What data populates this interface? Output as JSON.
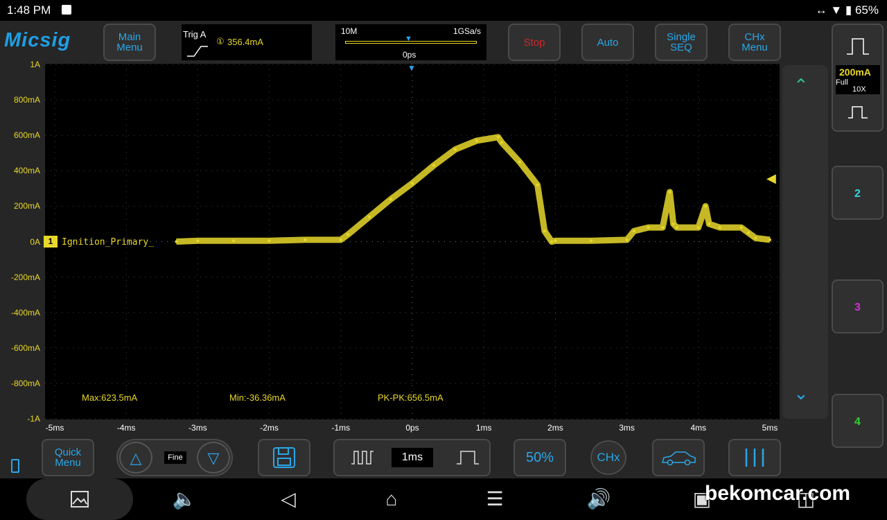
{
  "status": {
    "time": "1:48 PM",
    "battery": "65%"
  },
  "app": {
    "logo": "Micsig",
    "buttons": {
      "main_menu": [
        "Main",
        "Menu"
      ],
      "stop": "Stop",
      "auto": "Auto",
      "single_seq": [
        "Single",
        "SEQ"
      ],
      "chx_menu": [
        "CHx",
        "Menu"
      ],
      "quick_menu": [
        "Quick",
        "Menu"
      ],
      "fine": "Fine",
      "timebase": "1ms",
      "fifty": "50%",
      "chx": "CHx"
    },
    "trigger": {
      "label": "Trig A",
      "channel_mark": "①",
      "level": "356.4mA"
    },
    "timebase_box": {
      "memory": "10M",
      "sample_rate": "1GSa/s",
      "position": "0ps"
    },
    "channel1": {
      "scale": "200mA",
      "coupling": "Full",
      "probe": "10X",
      "name": "Ignition_Primary_",
      "marker": "1"
    },
    "channels": [
      "2",
      "3",
      "4"
    ],
    "colors": {
      "ch1": "#e8d82a",
      "ch2": "#33d6e0",
      "ch3": "#d033d0",
      "ch4": "#33d033",
      "accent": "#2aa7e8",
      "stop": "#d0262d"
    },
    "y_ticks": [
      "1A",
      "800mA",
      "600mA",
      "400mA",
      "200mA",
      "0A",
      "-200mA",
      "-400mA",
      "-600mA",
      "-800mA",
      "-1A"
    ],
    "x_ticks": [
      "-5ms",
      "-4ms",
      "-3ms",
      "-2ms",
      "-1ms",
      "0ps",
      "1ms",
      "2ms",
      "3ms",
      "4ms",
      "5ms"
    ],
    "measurements": {
      "max": "Max:623.5mA",
      "min": "Min:-36.36mA",
      "pkpk": "PK-PK:656.5mA"
    }
  },
  "watermark": "bekomcar.com",
  "chart_data": {
    "type": "line",
    "xlabel": "",
    "ylabel": "",
    "xlim": [
      -5,
      5
    ],
    "ylim": [
      -1000,
      1000
    ],
    "grid": true,
    "series": [
      {
        "name": "Ignition_Primary_",
        "x": [
          -3.3,
          -3.0,
          -2.5,
          -2.0,
          -1.5,
          -1.0,
          -0.9,
          -0.6,
          -0.3,
          0.0,
          0.3,
          0.6,
          0.9,
          1.2,
          1.25,
          1.5,
          1.75,
          1.85,
          1.95,
          2.0,
          2.5,
          3.0,
          3.1,
          3.3,
          3.5,
          3.6,
          3.65,
          3.7,
          4.0,
          4.1,
          4.15,
          4.3,
          4.6,
          4.7,
          4.8,
          5.0
        ],
        "values": [
          0,
          5,
          5,
          5,
          10,
          10,
          40,
          140,
          240,
          330,
          430,
          520,
          570,
          590,
          560,
          450,
          320,
          60,
          0,
          5,
          5,
          10,
          60,
          80,
          80,
          280,
          100,
          80,
          80,
          200,
          100,
          80,
          80,
          50,
          20,
          10
        ]
      }
    ]
  }
}
